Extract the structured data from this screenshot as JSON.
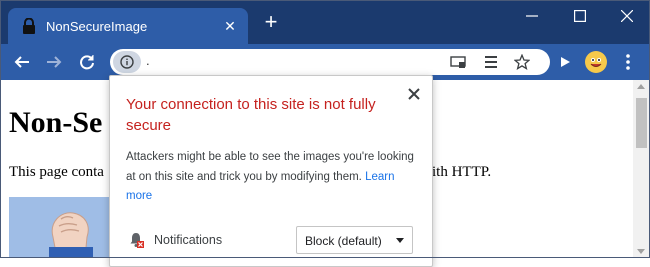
{
  "tab": {
    "title": "NonSecureImage",
    "close_glyph": "✕",
    "new_tab_glyph": "+"
  },
  "window": {
    "minimize_icon": "minimize-icon",
    "maximize_icon": "maximize-icon",
    "close_icon": "close-icon"
  },
  "toolbar": {
    "back_icon": "back-arrow-icon",
    "forward_icon": "forward-arrow-icon",
    "reload_icon": "reload-icon",
    "site_info_icon": "info-icon",
    "url": ".",
    "cast_icon": "cast-icon",
    "reader_icon": "reader-mode-icon",
    "bookmark_icon": "star-icon",
    "media_icon": "play-icon",
    "menu_icon": "more-vert-icon"
  },
  "page": {
    "heading": "Non-Se",
    "body_text_start": "This page conta",
    "body_text_end": "ith HTTP."
  },
  "popup": {
    "title": "Your connection to this site is not fully secure",
    "description": "Attackers might be able to see the images you're looking at on this site and trick you by modifying them.",
    "learn_more": "Learn more",
    "permission_label": "Notifications",
    "permission_value": "Block (default)"
  },
  "colors": {
    "tabstrip": "#1b3a6e",
    "toolbar": "#2e5da8",
    "warning_text": "#c5221f",
    "link": "#1a73e8"
  }
}
